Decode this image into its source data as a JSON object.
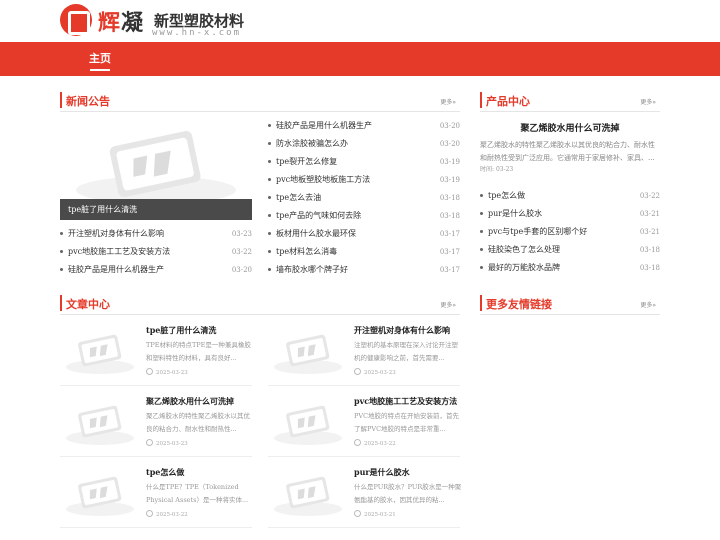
{
  "logo": {
    "name_a": "辉",
    "name_b": "凝",
    "tagline": "新型塑胶材料",
    "url": "www.hn-x.com"
  },
  "nav": {
    "home": "主页"
  },
  "news": {
    "title": "新闻公告",
    "more": "更多»",
    "featured_caption": "tpe脏了用什么清洗",
    "left_items": [
      {
        "title": "开注塑机对身体有什么影响",
        "date": "03-23"
      },
      {
        "title": "pvc地胶施工工艺及安装方法",
        "date": "03-22"
      },
      {
        "title": "硅胶产品是用什么机器生产",
        "date": "03-20"
      }
    ],
    "right_items": [
      {
        "title": "硅胶产品是用什么机器生产",
        "date": "03-20"
      },
      {
        "title": "防水涂胶被骗怎么办",
        "date": "03-20"
      },
      {
        "title": "tpe裂开怎么修复",
        "date": "03-19"
      },
      {
        "title": "pvc地板塑胶地板施工方法",
        "date": "03-19"
      },
      {
        "title": "tpe怎么去油",
        "date": "03-18"
      },
      {
        "title": "tpe产品的气味如何去除",
        "date": "03-18"
      },
      {
        "title": "板材用什么胶水最环保",
        "date": "03-17"
      },
      {
        "title": "tpe材料怎么消毒",
        "date": "03-17"
      },
      {
        "title": "墙布胶水哪个牌子好",
        "date": "03-17"
      }
    ]
  },
  "products": {
    "title": "产品中心",
    "more": "更多»",
    "featured_title": "聚乙烯胶水用什么可洗掉",
    "featured_desc": "聚乙烯胶水的特性聚乙烯胶水以其优良的粘合力、耐水性和耐热性受到广泛应用。它通常用于家居修补、家具、...",
    "featured_time_label": "时间:",
    "featured_time": "03-23",
    "items": [
      {
        "title": "tpe怎么做",
        "date": "03-22"
      },
      {
        "title": "pur是什么胶水",
        "date": "03-21"
      },
      {
        "title": "pvc与tpe手套的区别哪个好",
        "date": "03-21"
      },
      {
        "title": "硅胶染色了怎么处理",
        "date": "03-18"
      },
      {
        "title": "最好的万能胶水品牌",
        "date": "03-18"
      }
    ]
  },
  "articles": {
    "title": "文章中心",
    "more": "更多»",
    "items": [
      {
        "title": "tpe脏了用什么清洗",
        "desc": "TPE材料的特点TPE是一种兼具橡胶和塑料特性的材料，具有良好...",
        "date": "2025-03-23"
      },
      {
        "title": "开注塑机对身体有什么影响",
        "desc": "注塑机的基本原理在深入讨论开注塑机的健康影响之前，首先需要...",
        "date": "2025-03-23"
      },
      {
        "title": "聚乙烯胶水用什么可洗掉",
        "desc": "聚乙烯胶水的特性聚乙烯胶水以其优良的粘合力、耐水性和耐热性...",
        "date": "2025-03-23"
      },
      {
        "title": "pvc地胶施工工艺及安装方法",
        "desc": "PVC地胶的特点在开始安装前，首先了解PVC地胶的特点是非常重...",
        "date": "2025-03-22"
      },
      {
        "title": "tpe怎么做",
        "desc": "什么是TPE？TPE（Tokenized Physical Assets）是一种将实体...",
        "date": "2025-03-22"
      },
      {
        "title": "pur是什么胶水",
        "desc": "什么是PUR胶水？PUR胶水是一种聚氨酯基的胶水，因其优异的粘...",
        "date": "2025-03-21"
      }
    ]
  },
  "links": {
    "title": "更多友情链接",
    "more": "更多»"
  },
  "colors": {
    "brand": "#e53a2a"
  }
}
